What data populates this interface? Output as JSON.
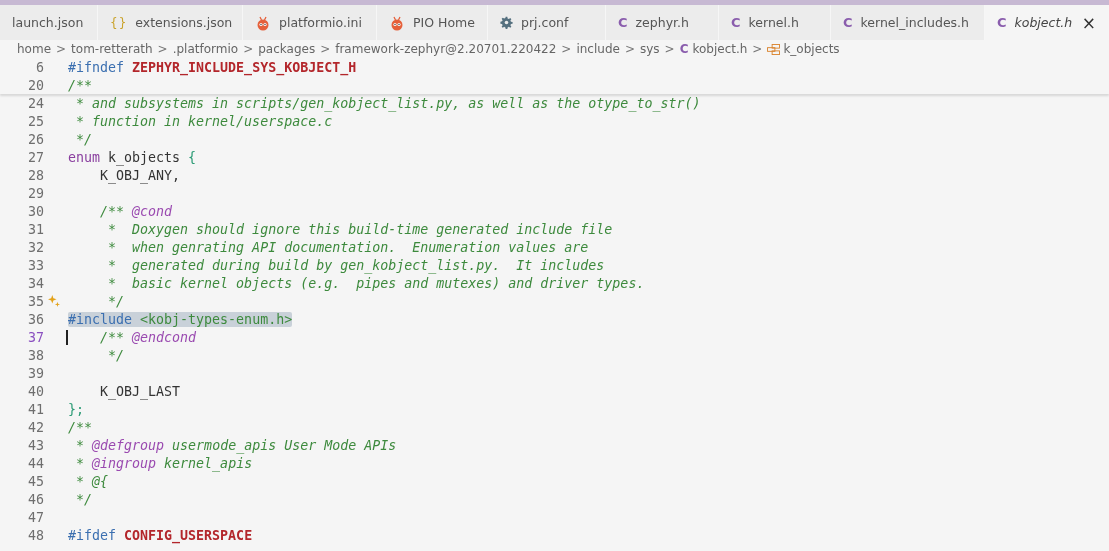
{
  "tabs": [
    {
      "label": "launch.json",
      "kind": "plain",
      "selected": false
    },
    {
      "label": "extensions.json",
      "kind": "braces",
      "icon_text": "{}",
      "selected": false
    },
    {
      "label": "platformio.ini",
      "kind": "ant",
      "selected": false
    },
    {
      "label": "PIO Home",
      "kind": "ant",
      "selected": false
    },
    {
      "label": "prj.conf",
      "kind": "gear",
      "selected": false
    },
    {
      "label": "zephyr.h",
      "kind": "c",
      "icon_text": "C",
      "selected": false
    },
    {
      "label": "kernel.h",
      "kind": "c",
      "icon_text": "C",
      "selected": false
    },
    {
      "label": "kernel_includes.h",
      "kind": "c",
      "icon_text": "C",
      "selected": false
    },
    {
      "label": "kobject.h",
      "kind": "c",
      "icon_text": "C",
      "selected": true,
      "close": "×"
    }
  ],
  "breadcrumb": {
    "separator": ">",
    "items": [
      {
        "label": "home",
        "kind": "plain"
      },
      {
        "label": "tom-retterath",
        "kind": "plain"
      },
      {
        "label": ".platformio",
        "kind": "plain"
      },
      {
        "label": "packages",
        "kind": "plain"
      },
      {
        "label": "framework-zephyr@2.20701.220422",
        "kind": "plain"
      },
      {
        "label": "include",
        "kind": "plain"
      },
      {
        "label": "sys",
        "kind": "plain"
      },
      {
        "label": "kobject.h",
        "kind": "c",
        "icon_text": "C"
      },
      {
        "label": "k_objects",
        "kind": "struct"
      }
    ]
  },
  "sticky_lines": [
    {
      "number": "6",
      "tokens": [
        {
          "kind": "directive",
          "text": "#ifndef "
        },
        {
          "kind": "macro",
          "text": "ZEPHYR_INCLUDE_SYS_KOBJECT_H"
        }
      ]
    },
    {
      "number": "20",
      "tokens": [
        {
          "kind": "comment",
          "text": "/**"
        }
      ]
    }
  ],
  "lines": [
    {
      "number": "24",
      "kind": "code",
      "tokens": [
        {
          "kind": "comment",
          "text": " * and subsystems in scripts/gen_kobject_list.py, as well as the otype_to_str()"
        }
      ]
    },
    {
      "number": "25",
      "kind": "code",
      "tokens": [
        {
          "kind": "comment",
          "text": " * function in kernel/userspace.c"
        }
      ]
    },
    {
      "number": "26",
      "kind": "code",
      "tokens": [
        {
          "kind": "comment",
          "text": " */"
        }
      ]
    },
    {
      "number": "27",
      "kind": "code",
      "tokens": [
        {
          "kind": "keyword",
          "text": "enum"
        },
        {
          "kind": "plain",
          "text": " k_objects "
        },
        {
          "kind": "brace",
          "text": "{"
        }
      ]
    },
    {
      "number": "28",
      "kind": "code",
      "tokens": [
        {
          "kind": "plain",
          "text": "    K_OBJ_ANY,"
        }
      ]
    },
    {
      "number": "29",
      "kind": "code"
    },
    {
      "number": "30",
      "kind": "code",
      "tokens": [
        {
          "kind": "comment",
          "text": "    /** "
        },
        {
          "kind": "doctag",
          "text": "@cond"
        }
      ]
    },
    {
      "number": "31",
      "kind": "code",
      "tokens": [
        {
          "kind": "comment",
          "text": "     *  Doxygen should ignore this build-time generated include file"
        }
      ]
    },
    {
      "number": "32",
      "kind": "code",
      "tokens": [
        {
          "kind": "comment",
          "text": "     *  when genrating API documentation.  Enumeration values are"
        }
      ]
    },
    {
      "number": "33",
      "kind": "code",
      "tokens": [
        {
          "kind": "comment",
          "text": "     *  generated during build by gen_kobject_list.py.  It includes"
        }
      ]
    },
    {
      "number": "34",
      "kind": "code",
      "tokens": [
        {
          "kind": "comment",
          "text": "     *  basic kernel objects (e.g.  pipes and mutexes) and driver types."
        }
      ]
    },
    {
      "number": "35",
      "kind": "hint",
      "tokens": [
        {
          "kind": "comment",
          "text": "     */"
        }
      ]
    },
    {
      "number": "36",
      "kind": "selection",
      "tokens": [
        {
          "kind": "directive",
          "text": "#include"
        },
        {
          "kind": "string",
          "text": " <kobj-types-enum.h>"
        }
      ]
    },
    {
      "number": "37",
      "kind": "cursor",
      "tokens": [
        {
          "kind": "comment",
          "text": "    /** "
        },
        {
          "kind": "doctag",
          "text": "@endcond"
        }
      ]
    },
    {
      "number": "38",
      "kind": "code",
      "tokens": [
        {
          "kind": "comment",
          "text": "     */"
        }
      ]
    },
    {
      "number": "39",
      "kind": "code"
    },
    {
      "number": "40",
      "kind": "code",
      "tokens": [
        {
          "kind": "plain",
          "text": "    K_OBJ_LAST"
        }
      ]
    },
    {
      "number": "41",
      "kind": "code",
      "tokens": [
        {
          "kind": "brace",
          "text": "};"
        }
      ]
    },
    {
      "number": "42",
      "kind": "code",
      "tokens": [
        {
          "kind": "comment",
          "text": "/**"
        }
      ]
    },
    {
      "number": "43",
      "kind": "code",
      "tokens": [
        {
          "kind": "comment",
          "text": " * "
        },
        {
          "kind": "doctag",
          "text": "@defgroup"
        },
        {
          "kind": "comment",
          "text": " usermode_apis User Mode APIs"
        }
      ]
    },
    {
      "number": "44",
      "kind": "code",
      "tokens": [
        {
          "kind": "comment",
          "text": " * "
        },
        {
          "kind": "doctag",
          "text": "@ingroup"
        },
        {
          "kind": "comment",
          "text": " kernel_apis"
        }
      ]
    },
    {
      "number": "45",
      "kind": "code",
      "tokens": [
        {
          "kind": "comment",
          "text": " * @{"
        }
      ]
    },
    {
      "number": "46",
      "kind": "code",
      "tokens": [
        {
          "kind": "comment",
          "text": " */"
        }
      ]
    },
    {
      "number": "47",
      "kind": "code"
    },
    {
      "number": "48",
      "kind": "code",
      "tokens": [
        {
          "kind": "directive",
          "text": "#ifdef "
        },
        {
          "kind": "macro",
          "text": "CONFIG_USERSPACE"
        }
      ]
    }
  ]
}
